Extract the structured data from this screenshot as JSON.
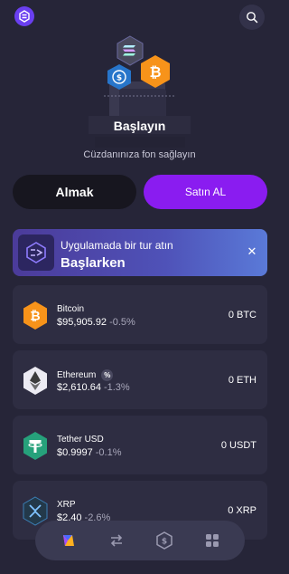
{
  "header": {
    "logo": "app-logo-icon",
    "search": "search-icon"
  },
  "hero": {
    "title": "Başlayın",
    "subtitle": "Cüzdanınıza fon sağlayın",
    "coins": [
      "solana-coin-icon",
      "usdc-coin-icon",
      "bitcoin-coin-icon"
    ]
  },
  "actions": {
    "sell_label": "Almak",
    "buy_label": "Satın AL"
  },
  "banner": {
    "line1": "Uygulamada bir tur atın",
    "line2": "Başlarken",
    "close_icon": "close-icon"
  },
  "assets": [
    {
      "name": "Bitcoin",
      "price": "$95,905.92",
      "change": "-0.5%",
      "balance": "0 BTC",
      "icon": "bitcoin-icon",
      "color": "#f7931a"
    },
    {
      "name": "Ethereum",
      "price": "$2,610.64",
      "change": "-1.3%",
      "balance": "0 ETH",
      "icon": "ethereum-icon",
      "color": "#ecebf3",
      "badge": "%"
    },
    {
      "name": "Tether USD",
      "price": "$0.9997",
      "change": "-0.1%",
      "balance": "0 USDT",
      "icon": "tether-icon",
      "color": "#26a17b"
    },
    {
      "name": "XRP",
      "price": "$2.40",
      "change": "-2.6%",
      "balance": "0 XRP",
      "icon": "xrp-icon",
      "color": "#23292f"
    }
  ],
  "nav": [
    "wallet-nav-icon",
    "swap-nav-icon",
    "earn-nav-icon",
    "apps-nav-icon"
  ],
  "colors": {
    "background": "#262538",
    "accent": "#8a1cf0",
    "card": "#2e2d42"
  }
}
